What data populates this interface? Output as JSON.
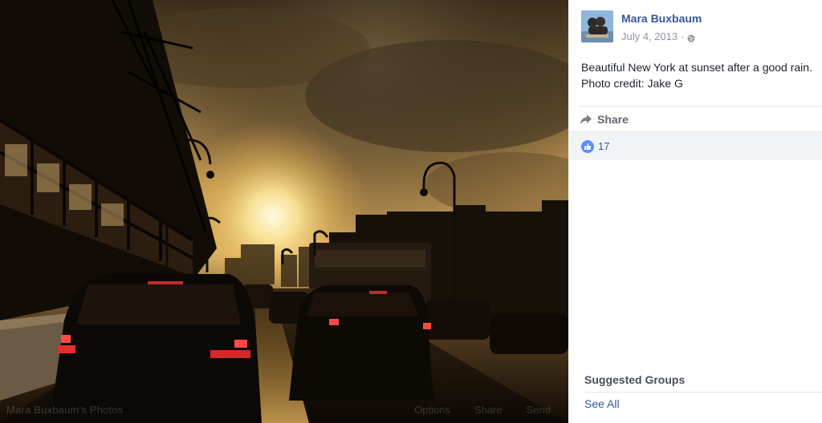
{
  "photo": {
    "album_link": "Mara Buxbaum's Photos",
    "actions": [
      "Options",
      "Share",
      "Send"
    ]
  },
  "post": {
    "author": "Mara Buxbaum",
    "date": "July 4, 2013",
    "separator": "·",
    "privacy_icon": "globe-icon",
    "caption": "Beautiful New York at sunset after a good rain.\nPhoto credit: Jake G"
  },
  "actions": {
    "share_label": "Share"
  },
  "reactions": {
    "icon": "like-icon",
    "count": "17"
  },
  "suggested_groups": {
    "title": "Suggested Groups",
    "see_all": "See All"
  },
  "colors": {
    "link": "#365899",
    "like": "#5890ff",
    "muted": "#90949c"
  }
}
